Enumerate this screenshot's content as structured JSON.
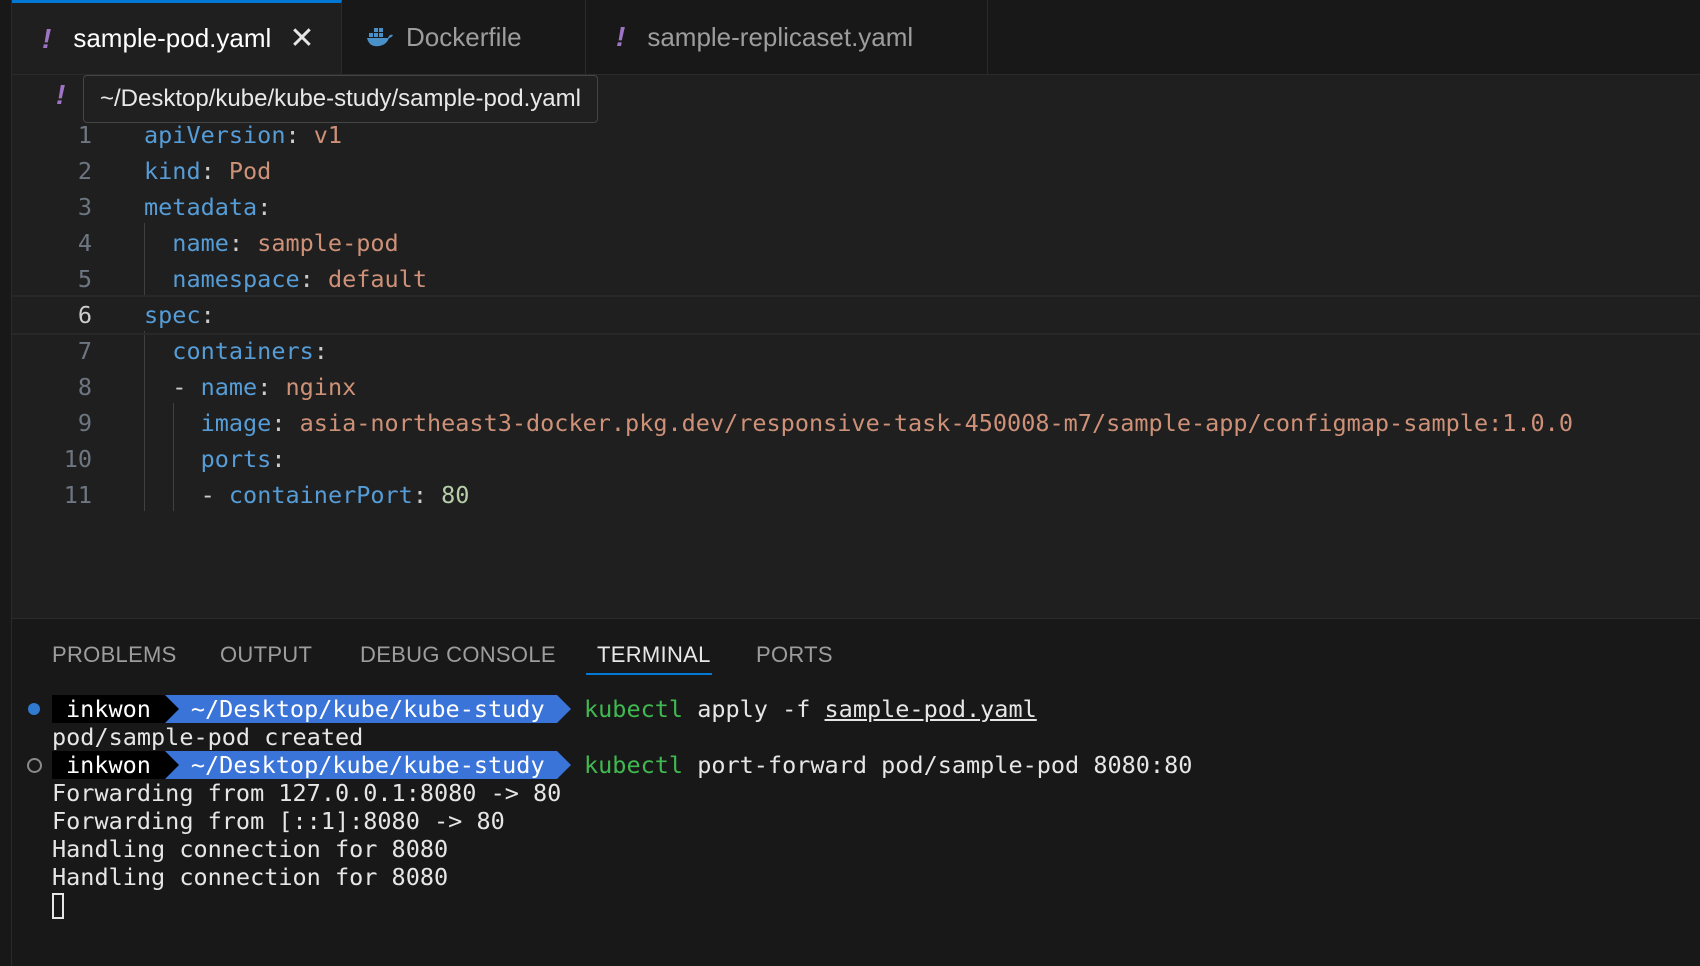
{
  "tabs": [
    {
      "label": "sample-pod.yaml",
      "icon": "yaml-icon",
      "active": true
    },
    {
      "label": "Dockerfile",
      "icon": "docker-icon",
      "active": false
    },
    {
      "label": "sample-replicaset.yaml",
      "icon": "yaml-icon",
      "active": false
    }
  ],
  "tab_close_glyph": "✕",
  "yaml_glyph": "!",
  "breadcrumb": {
    "tooltip": "~/Desktop/kube/kube-study/sample-pod.yaml"
  },
  "editor": {
    "current_line": 6,
    "line_numbers": [
      "1",
      "2",
      "3",
      "4",
      "5",
      "6",
      "7",
      "8",
      "9",
      "10",
      "11"
    ],
    "lines": [
      {
        "key": "apiVersion",
        "value": "v1"
      },
      {
        "key": "kind",
        "value": "Pod"
      },
      {
        "key": "metadata",
        "value": ""
      },
      {
        "key": "name",
        "value": "sample-pod"
      },
      {
        "key": "namespace",
        "value": "default"
      },
      {
        "key": "spec",
        "value": ""
      },
      {
        "key": "containers",
        "value": ""
      },
      {
        "dash": "-",
        "key": "name",
        "value": "nginx"
      },
      {
        "key": "image",
        "value": "asia-northeast3-docker.pkg.dev/responsive-task-450008-m7/sample-app/configmap-sample:1.0.0"
      },
      {
        "key": "ports",
        "value": ""
      },
      {
        "dash": "-",
        "key": "containerPort",
        "value": "80"
      }
    ]
  },
  "panel": {
    "tabs": [
      "PROBLEMS",
      "OUTPUT",
      "DEBUG CONSOLE",
      "TERMINAL",
      "PORTS"
    ],
    "active_tab": "TERMINAL"
  },
  "terminal": {
    "prompt_user": "inkwon",
    "prompt_path": "~/Desktop/kube/kube-study",
    "cmd1": {
      "exe": "kubectl",
      "args": " apply -f ",
      "file": "sample-pod.yaml"
    },
    "out1": "pod/sample-pod created",
    "cmd2": {
      "exe": "kubectl",
      "args": " port-forward pod/sample-pod 8080:80"
    },
    "out2": [
      "Forwarding from 127.0.0.1:8080 -> 80",
      "Forwarding from [::1]:8080 -> 80",
      "Handling connection for 8080",
      "Handling connection for 8080"
    ]
  }
}
